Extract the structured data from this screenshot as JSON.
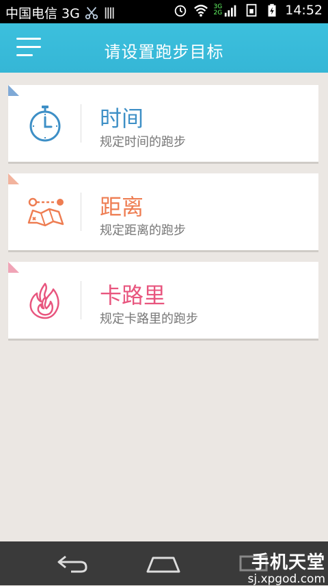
{
  "status_bar": {
    "carrier": "中国电信 3G",
    "time": "14:52",
    "signal_labels": [
      "3G",
      "2G"
    ]
  },
  "header": {
    "title": "请设置跑步目标",
    "menu_icon": "hamburger-menu-icon"
  },
  "goals": [
    {
      "name": "时间",
      "desc": "规定时间的跑步",
      "icon": "stopwatch-icon",
      "color": "#3d8fc6",
      "corner": "#7fa9d6"
    },
    {
      "name": "距离",
      "desc": "规定距离的跑步",
      "icon": "map-route-icon",
      "color": "#ee7d52",
      "corner": "#f2b39d"
    },
    {
      "name": "卡路里",
      "desc": "规定卡路里的跑步",
      "icon": "flame-icon",
      "color": "#e8557e",
      "corner": "#f0a4b6"
    }
  ],
  "nav_bar": {
    "back_icon": "back-arrow-icon",
    "home_icon": "home-icon",
    "menu_icon": "recent-menu-icon"
  },
  "watermark": {
    "brand": "手机天堂",
    "url": "sj.xpgod.com"
  }
}
